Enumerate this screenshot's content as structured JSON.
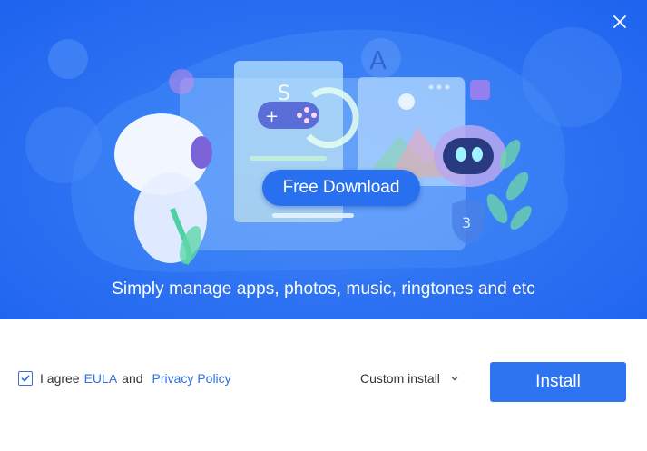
{
  "hero": {
    "free_download_label": "Free Download",
    "tagline": "Simply manage apps, photos, music, ringtones and etc",
    "badge_number": "3"
  },
  "footer": {
    "agree_prefix": "I agree",
    "eula_link": "EULA",
    "and_text": "and",
    "privacy_link": "Privacy Policy",
    "agree_checked": true,
    "custom_install_label": "Custom install",
    "install_label": "Install"
  },
  "colors": {
    "hero_blue": "#2f74f3",
    "accent_blue": "#2e73f0",
    "link_blue": "#2f6fe0"
  },
  "icons": [
    "close-icon",
    "checkmark-icon",
    "chevron-down-icon",
    "gamepad-icon",
    "app-store-icon",
    "robot-icon",
    "shield-icon",
    "image-icon",
    "refresh-icon"
  ]
}
